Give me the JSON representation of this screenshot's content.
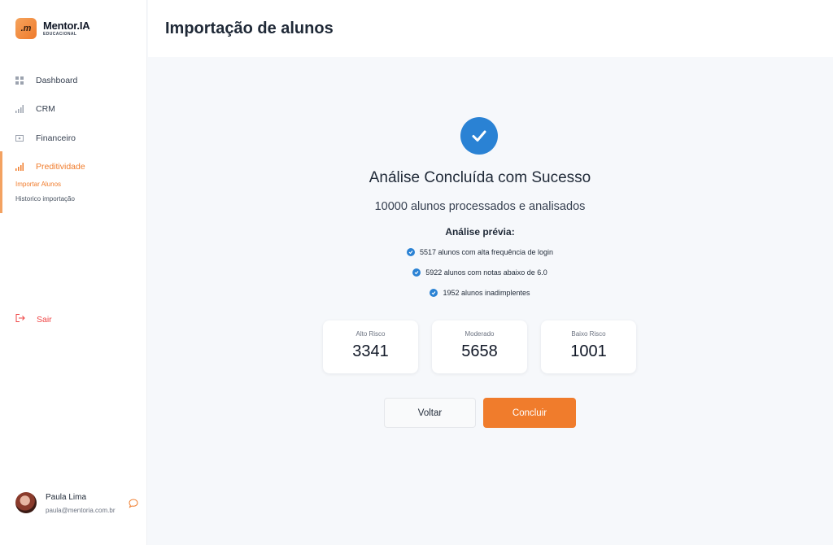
{
  "brand": {
    "name": "Mentor.IA",
    "subtitle": "EDUCACIONAL",
    "logo_mark": ".m"
  },
  "sidebar": {
    "items": [
      {
        "label": "Dashboard",
        "icon": "grid-icon"
      },
      {
        "label": "CRM",
        "icon": "bar-chart-icon"
      },
      {
        "label": "Financeiro",
        "icon": "money-icon"
      },
      {
        "label": "Preditividade",
        "icon": "bar-chart-icon"
      }
    ],
    "subitems": [
      {
        "label": "Importar Alunos"
      },
      {
        "label": "Historico importação"
      }
    ],
    "logout": "Sair"
  },
  "user": {
    "name": "Paula Lima",
    "email": "paula@mentoria.com.br"
  },
  "header": {
    "title": "Importação de alunos"
  },
  "result": {
    "headline": "Análise Concluída com Sucesso",
    "summary": "10000 alunos processados e analisados",
    "preview_title": "Análise prévia:",
    "bullets": [
      "5517 alunos com alta frequência de login",
      "5922 alunos com notas abaixo de 6.0",
      "1952 alunos inadimplentes"
    ],
    "cards": [
      {
        "label": "Alto Risco",
        "value": "3341"
      },
      {
        "label": "Moderado",
        "value": "5658"
      },
      {
        "label": "Baixo Risco",
        "value": "1001"
      }
    ]
  },
  "actions": {
    "back": "Voltar",
    "done": "Concluir"
  },
  "colors": {
    "accent": "#f07c2c",
    "primary_blue": "#2a82d4",
    "danger": "#ef4444"
  }
}
